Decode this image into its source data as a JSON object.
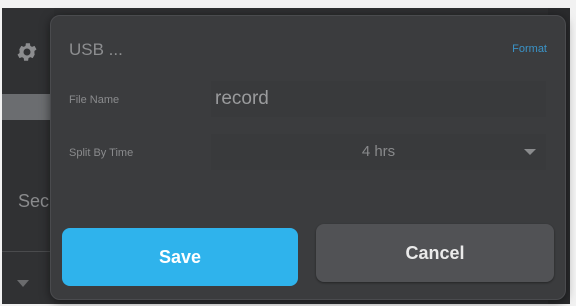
{
  "background": {
    "section_label_partial": "Sec",
    "icons": [
      "gear-icon",
      "chevron-down-icon"
    ]
  },
  "dialog": {
    "title": "USB ...",
    "format_link": "Format",
    "file_name": {
      "label": "File Name",
      "value": "record"
    },
    "split_by_time": {
      "label": "Split By Time",
      "value": "4 hrs",
      "icon": "caret-down-icon"
    },
    "save_label": "Save",
    "cancel_label": "Cancel"
  },
  "colors": {
    "accent": "#2fb3ec",
    "link": "#3a93c7",
    "dialog_bg": "#3b3c3e",
    "cancel_bg": "#515255"
  }
}
